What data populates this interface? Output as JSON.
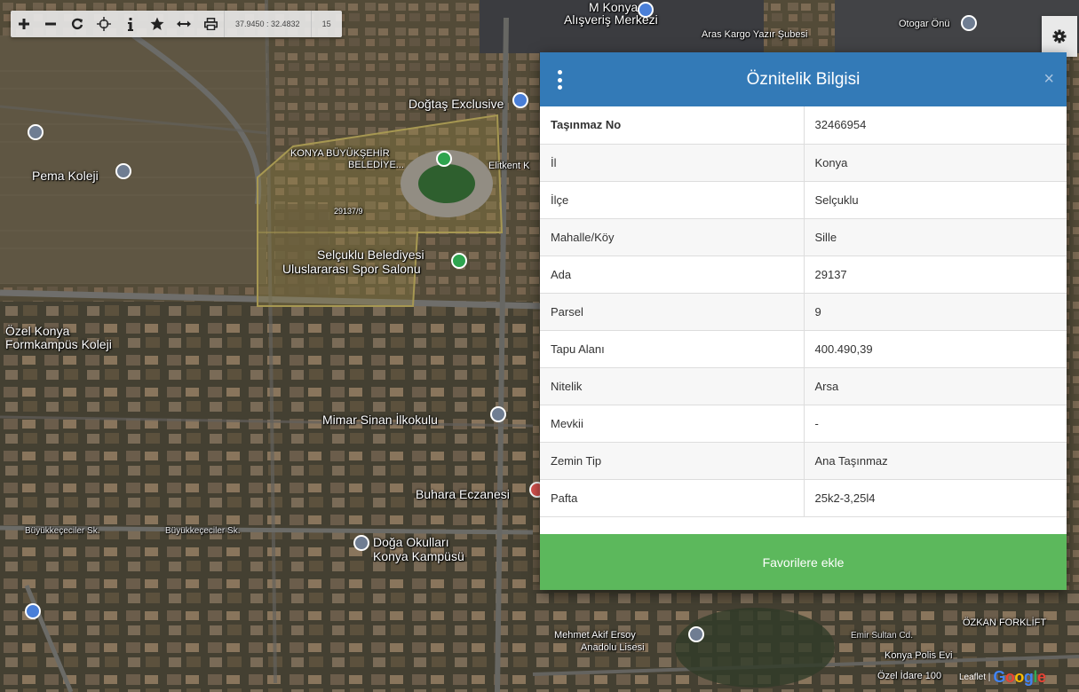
{
  "toolbar": {
    "coordinates": "37.9450 : 32.4832",
    "zoom": "15"
  },
  "map": {
    "labels": {
      "alisveris_merkezi": "Alışveriş Merkezi",
      "konya_top": "M Konya",
      "aras_kargo": "Aras Kargo Yazır Şubesi",
      "otogar": "Otogar Önü",
      "dogtas": "Doğtaş Exclusive",
      "buyuksehir": "KONYA BÜYÜKŞEHİR",
      "belediye": "BELEDİYE...",
      "elit": "Elitkent K",
      "parcel_id": "29137/9",
      "selcuklu": "Selçuklu Belediyesi",
      "uluslararasi": "Uluslararası Spor Salonu",
      "pema": "Pema Koleji",
      "ozel_konya": "Özel Konya",
      "formkampus": "Formkampüs Koleji",
      "mimar_sinan": "Mimar Sinan İlkokulu",
      "buhara": "Buhara Eczanesi",
      "buyukkececiler1": "Büyükkeçeciler Sk.",
      "buyukkececiler2": "Büyükkeçeciler Sk.",
      "doga_okullari": "Doğa Okulları",
      "konya_kampusu": "Konya Kampüsü",
      "mehmet_akif": "Mehmet Akif Ersoy",
      "anadolu_lisesi": "Anadolu Lisesi",
      "ozkan": "ÖZKAN FORKLİFT",
      "emir_sultan": "Emir Sultan Cd.",
      "konya_polis": "Konya Polis Evi",
      "ozel_idare": "Özel İdare 100"
    }
  },
  "panel": {
    "title": "Öznitelik Bilgisi",
    "rows": [
      {
        "key": "Taşınmaz No",
        "value": "32466954"
      },
      {
        "key": "İl",
        "value": "Konya"
      },
      {
        "key": "İlçe",
        "value": "Selçuklu"
      },
      {
        "key": "Mahalle/Köy",
        "value": "Sille"
      },
      {
        "key": "Ada",
        "value": "29137"
      },
      {
        "key": "Parsel",
        "value": "9"
      },
      {
        "key": "Tapu Alanı",
        "value": "400.490,39"
      },
      {
        "key": "Nitelik",
        "value": "Arsa"
      },
      {
        "key": "Mevkii",
        "value": "-"
      },
      {
        "key": "Zemin Tip",
        "value": "Ana Taşınmaz"
      },
      {
        "key": "Pafta",
        "value": "25k2-3,25l4"
      }
    ],
    "favorite_button": "Favorilere ekle"
  },
  "attribution": {
    "leaflet": "Leaflet |",
    "google": "Google"
  },
  "colors": {
    "header": "#337ab7",
    "button": "#5cb85c"
  }
}
